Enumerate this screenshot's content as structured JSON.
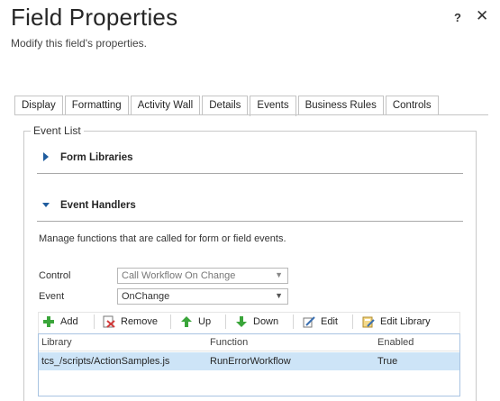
{
  "dialog": {
    "title": "Field Properties",
    "subtitle": "Modify this field's properties.",
    "help_label": "?",
    "close_label": "✕"
  },
  "tabs": [
    {
      "label": "Display",
      "active": false
    },
    {
      "label": "Formatting",
      "active": false
    },
    {
      "label": "Activity Wall",
      "active": false
    },
    {
      "label": "Details",
      "active": false
    },
    {
      "label": "Events",
      "active": true
    },
    {
      "label": "Business Rules",
      "active": false
    },
    {
      "label": "Controls",
      "active": false
    }
  ],
  "event_list": {
    "legend": "Event List",
    "form_libraries": {
      "label": "Form Libraries",
      "expanded": false
    },
    "event_handlers": {
      "label": "Event Handlers",
      "expanded": true,
      "description": "Manage functions that are called for form or field events.",
      "control": {
        "label": "Control",
        "value": "Call Workflow On Change",
        "disabled": true
      },
      "event": {
        "label": "Event",
        "value": "OnChange",
        "disabled": false
      }
    }
  },
  "toolbar": {
    "add_label": "Add",
    "remove_label": "Remove",
    "up_label": "Up",
    "down_label": "Down",
    "edit_label": "Edit",
    "edit_library_label": "Edit Library"
  },
  "grid": {
    "columns": [
      "Library",
      "Function",
      "Enabled"
    ],
    "rows": [
      {
        "library": "tcs_/scripts/ActionSamples.js",
        "function": "RunErrorWorkflow",
        "enabled": "True",
        "selected": true
      }
    ]
  },
  "colors": {
    "accent_arrow": "#1f5c9e",
    "selected_row": "#cde4f7",
    "add_icon": "#3aa53a",
    "remove_icon": "#d23b3b",
    "up_down_icon": "#3aa53a"
  },
  "icons": {
    "add": "plus-icon",
    "remove": "remove-icon",
    "up": "up-arrow-icon",
    "down": "down-arrow-icon",
    "edit": "edit-icon",
    "edit_library": "edit-library-icon"
  }
}
